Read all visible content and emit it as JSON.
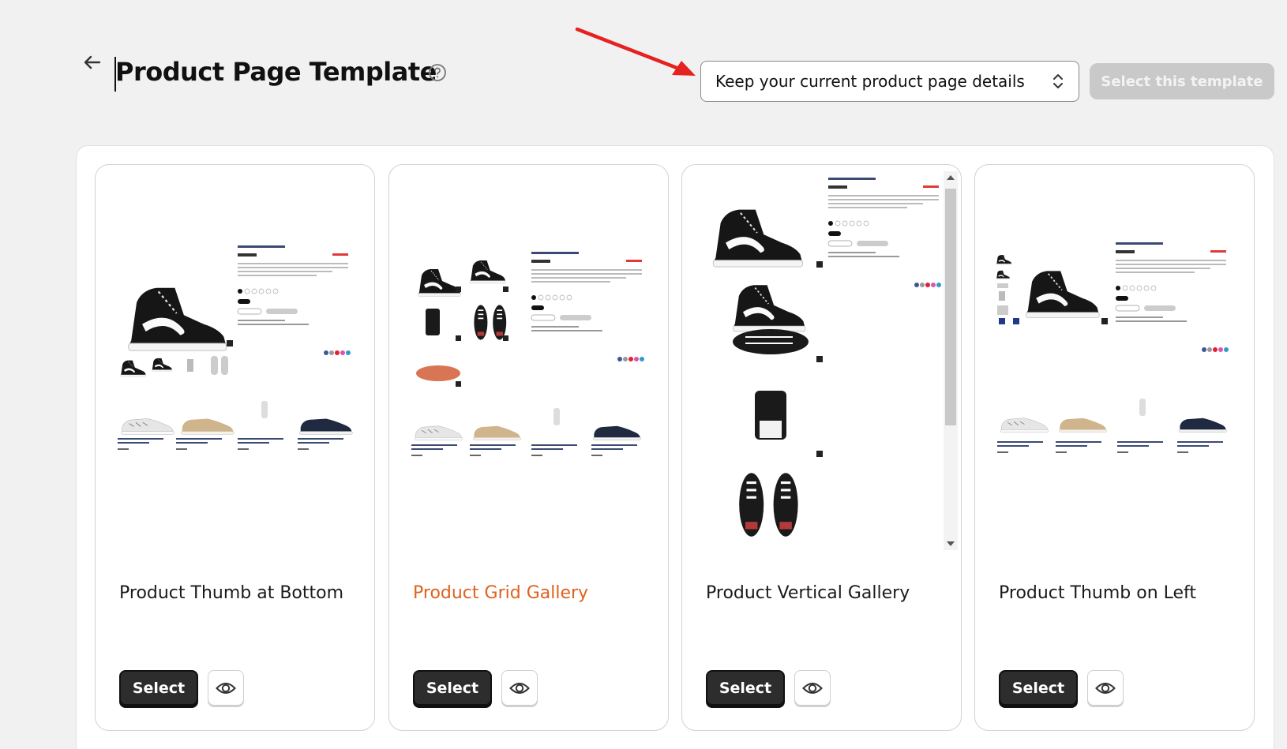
{
  "header": {
    "title": "Product Page Template",
    "dropdown_value": "Keep your current product page details",
    "select_template_label": "Select this template"
  },
  "cards": [
    {
      "name": "Product Thumb at Bottom",
      "select_label": "Select"
    },
    {
      "name": "Product Grid Gallery",
      "select_label": "Select"
    },
    {
      "name": "Product Vertical Gallery",
      "select_label": "Select"
    },
    {
      "name": "Product Thumb on Left",
      "select_label": "Select"
    }
  ],
  "colors": {
    "accent": "#e0611c",
    "arrow": "#e5221f",
    "dark_button": "#2d2d2d",
    "disabled_button": "#c9c9c9"
  },
  "icons": {
    "back": "arrow-left-icon",
    "help": "question-circle-icon",
    "dropdown": "chevron-up-down-icon",
    "preview": "eye-icon"
  }
}
